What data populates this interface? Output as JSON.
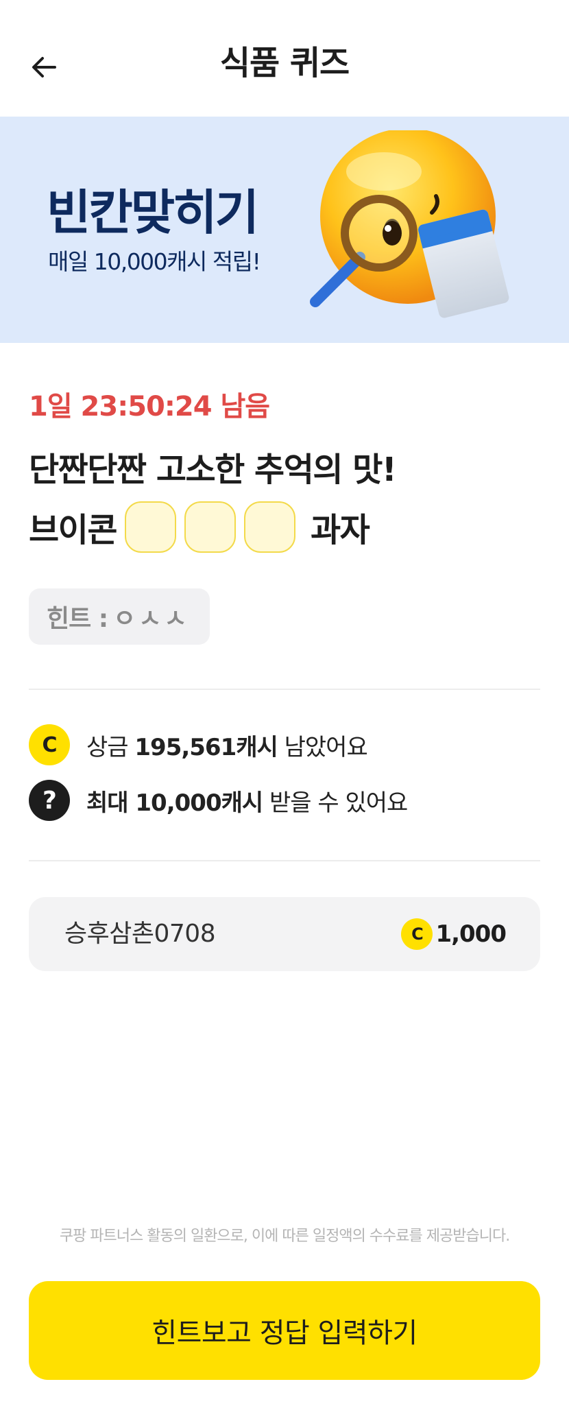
{
  "header": {
    "title": "식품 퀴즈",
    "back_icon": "arrow-left-icon"
  },
  "banner": {
    "title": "빈칸맞히기",
    "subtitle": "매일 10,000캐시 적립!",
    "bg_color": "#dde9fb",
    "text_color": "#0e2a5e"
  },
  "quiz": {
    "timer": "1일 23:50:24 남음",
    "timer_color": "#e04a47",
    "question_line1": "단짠단짠 고소한 추억의 맛!",
    "question_prefix": "브이콘",
    "question_suffix": "과자",
    "blank_count": 3,
    "hint_label": "힌트 :",
    "hint_value": "ㅇㅅㅅ"
  },
  "info": {
    "prize_pre": "상금",
    "prize_amount": "195,561캐시",
    "prize_post": "남았어요",
    "prize_icon_text": "C",
    "max_amount": "최대 10,000캐시",
    "max_post": "받을 수 있어요",
    "max_icon_text": "?"
  },
  "winners": [
    {
      "name": "승후삼촌0708",
      "coin_text": "C",
      "amount": "1,000"
    }
  ],
  "disclaimer": "쿠팡 파트너스 활동의 일환으로, 이에 따른 일정액의 수수료를 제공받습니다.",
  "cta": {
    "label": "힌트보고 정답 입력하기",
    "color": "#ffe000"
  }
}
